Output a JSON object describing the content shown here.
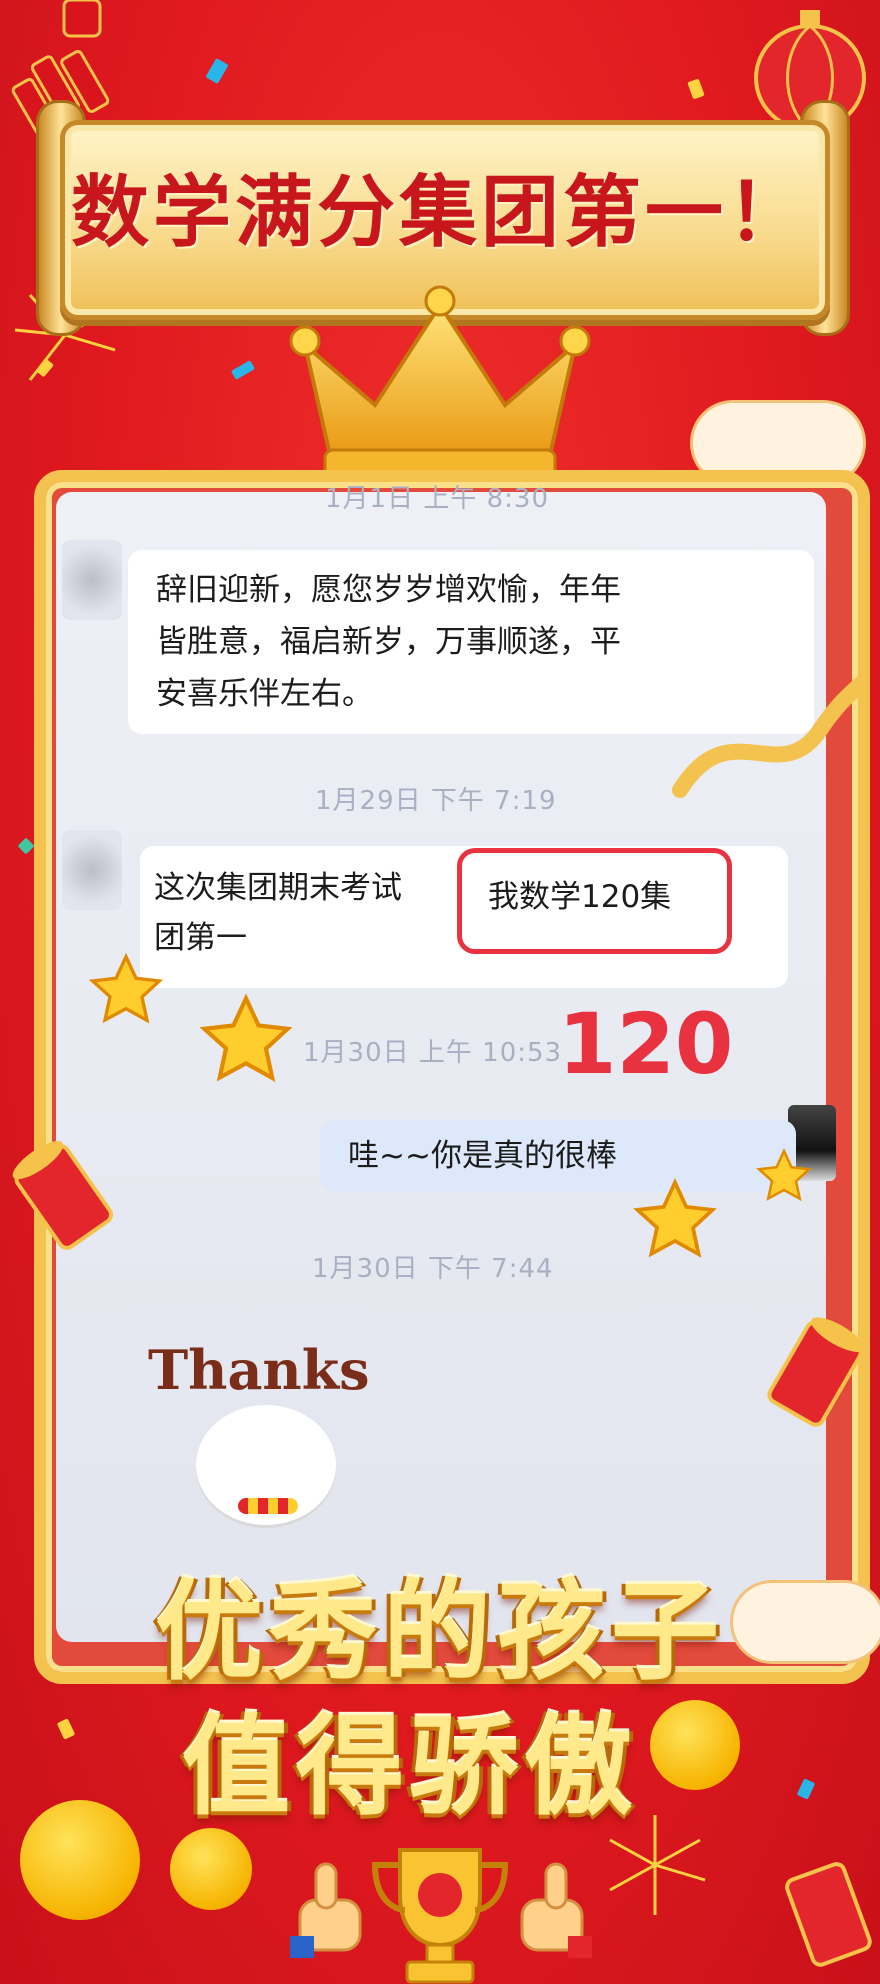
{
  "banner": {
    "title": "数学满分集团第一！"
  },
  "chat": {
    "top_timestamp": "1月1日 上午 8:30",
    "message_1": {
      "line1": "辞旧迎新，愿您岁岁增欢愉，年年",
      "line2": "皆胜意，福启新岁，万事顺遂，平",
      "line3": "安喜乐伴左右。"
    },
    "timestamp_2": "1月29日 下午 7:19",
    "message_2": {
      "part1": "这次集团期末考试",
      "highlight": "我数学120集",
      "part2": "团第一"
    },
    "callout_score": "120",
    "timestamp_3": "1月30日 上午 10:53",
    "message_3": "哇~~你是真的很棒",
    "timestamp_4": "1月30日 下午 7:44",
    "sticker_text": "Thanks"
  },
  "slogan": {
    "line1": "优秀的孩子",
    "line2": "值得骄傲"
  },
  "colors": {
    "background_red": "#e01a1f",
    "gold": "#f4c34f",
    "highlight_red": "#e8323f",
    "slogan_yellow": "#ffe98a"
  },
  "icons": [
    "firecracker-icon",
    "lantern-icon",
    "crown-icon",
    "star-icon",
    "party-popper-icon",
    "trophy-icon",
    "thumbs-up-icon",
    "party-face-emoji",
    "heart-eyes-emoji",
    "cloud-icon",
    "fireworks-icon",
    "ribbon-icon"
  ]
}
